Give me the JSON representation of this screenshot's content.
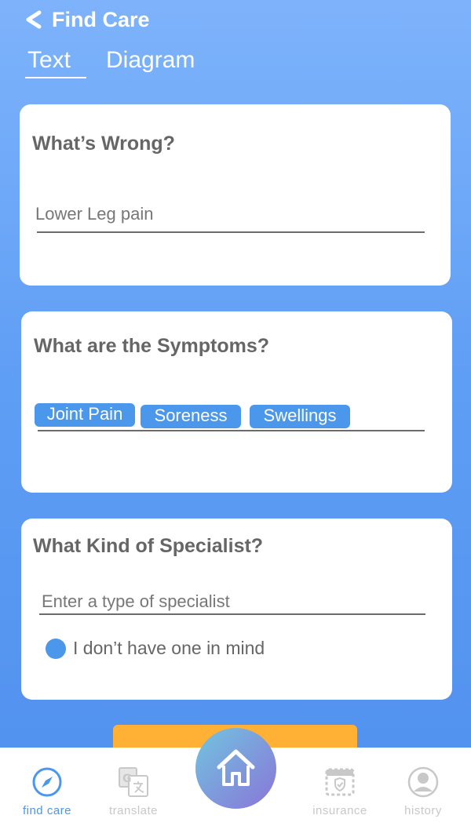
{
  "header": {
    "title": "Find Care"
  },
  "tabs": [
    {
      "label": "Text",
      "active": true
    },
    {
      "label": "Diagram",
      "active": false
    }
  ],
  "cards": {
    "whats_wrong": {
      "title": "What’s Wrong?",
      "value": "Lower Leg pain"
    },
    "symptoms": {
      "title": "What are the Symptoms?",
      "chips": [
        "Joint Pain",
        "Soreness",
        "Swellings"
      ]
    },
    "specialist": {
      "title": "What Kind of Specialist?",
      "placeholder": "Enter a type of specialist",
      "radio_label": "I don’t have one in mind"
    }
  },
  "nav": {
    "items": [
      {
        "label": "find care",
        "icon": "compass-icon"
      },
      {
        "label": "translate",
        "icon": "translate-icon"
      },
      {
        "label": "insurance",
        "icon": "insurance-card-icon"
      },
      {
        "label": "history",
        "icon": "user-icon"
      }
    ],
    "home_icon": "home-icon"
  },
  "colors": {
    "background_top": "#7eb3fb",
    "background_bottom": "#4f90ee",
    "accent": "#4a97ec",
    "cta": "#ffb136",
    "nav_active": "#4a97ec",
    "nav_inactive": "#c8c8c8"
  }
}
